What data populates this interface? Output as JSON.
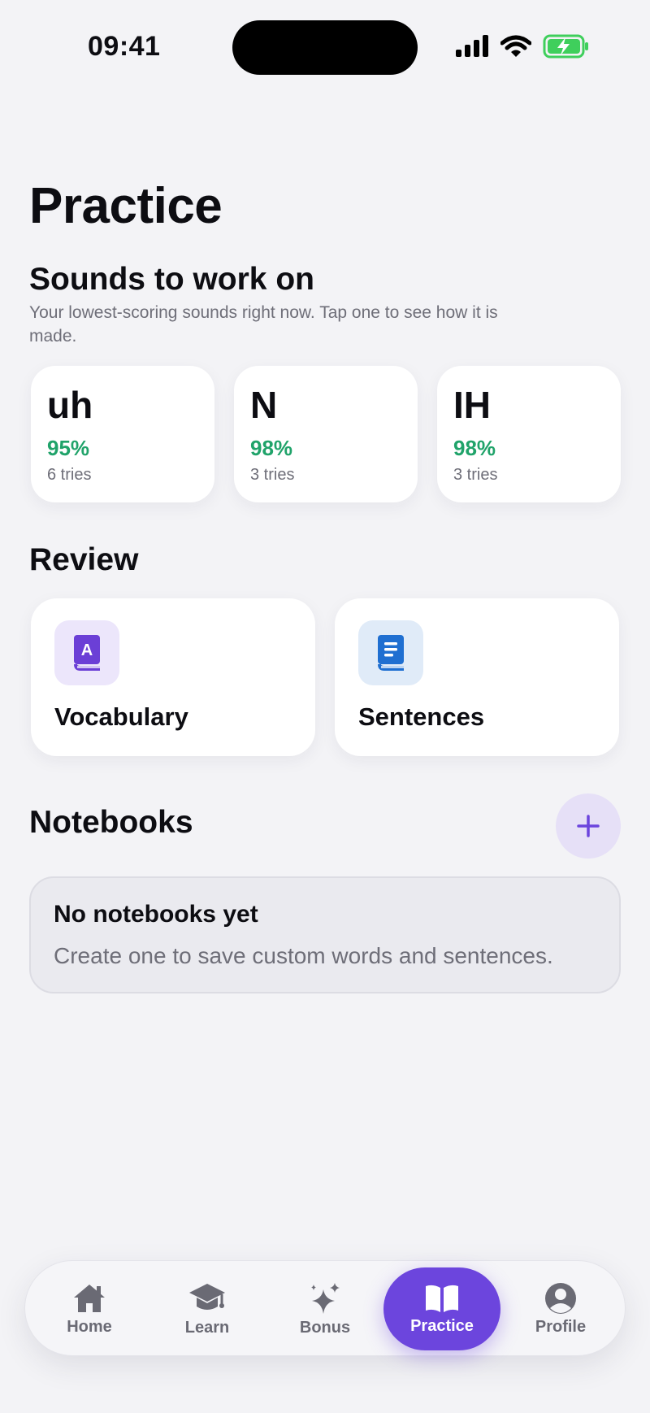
{
  "status_bar": {
    "time": "09:41"
  },
  "page": {
    "title": "Practice"
  },
  "sounds": {
    "title": "Sounds to work on",
    "subtitle": "Your lowest-scoring sounds right now. Tap one to see how it is made.",
    "items": [
      {
        "symbol": "uh",
        "score": "95%",
        "tries": "6 tries"
      },
      {
        "symbol": "N",
        "score": "98%",
        "tries": "3 tries"
      },
      {
        "symbol": "IH",
        "score": "98%",
        "tries": "3 tries"
      }
    ]
  },
  "review": {
    "title": "Review",
    "items": [
      {
        "label": "Vocabulary",
        "icon": "vocabulary-book-icon"
      },
      {
        "label": "Sentences",
        "icon": "sentences-book-icon"
      }
    ]
  },
  "notebooks": {
    "title": "Notebooks",
    "add_icon": "plus-icon",
    "empty_title": "No notebooks yet",
    "empty_body": "Create one to save custom words and sentences."
  },
  "tabbar": {
    "items": [
      {
        "label": "Home",
        "icon": "home-icon"
      },
      {
        "label": "Learn",
        "icon": "graduation-cap-icon"
      },
      {
        "label": "Bonus",
        "icon": "sparkles-icon"
      },
      {
        "label": "Practice",
        "icon": "open-book-icon",
        "active": true
      },
      {
        "label": "Profile",
        "icon": "person-circle-icon"
      }
    ]
  },
  "colors": {
    "accent": "#6c45dd",
    "score_green": "#20a36a",
    "background": "#f3f3f6"
  }
}
